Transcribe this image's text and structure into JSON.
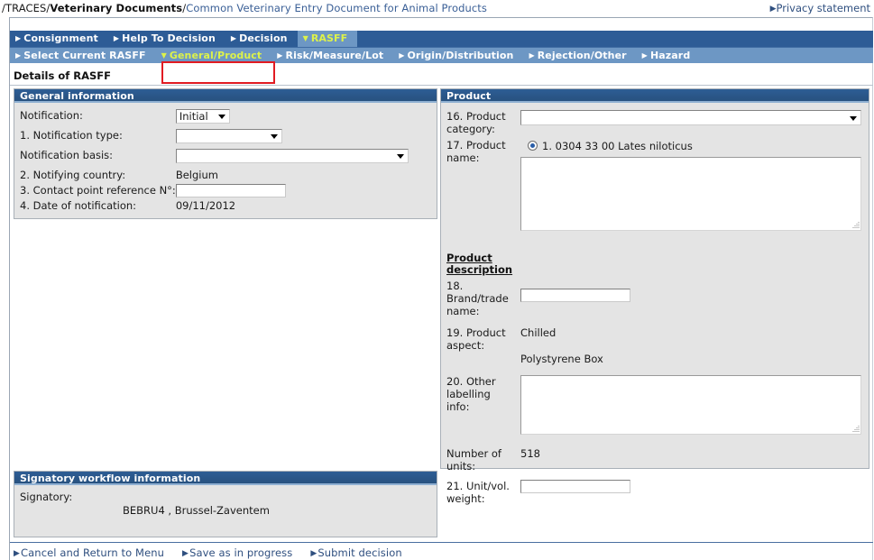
{
  "breadcrumb": {
    "root": "/TRACES/",
    "section": "Veterinary Documents",
    "separator": "/",
    "current": "Common Veterinary Entry Document for Animal Products"
  },
  "privacy": {
    "label": "Privacy statement",
    "arrow": "▶"
  },
  "tabs_primary": [
    {
      "label": "Consignment",
      "arrow": "▶",
      "active": false
    },
    {
      "label": "Help To Decision",
      "arrow": "▶",
      "active": false
    },
    {
      "label": "Decision",
      "arrow": "▶",
      "active": false
    },
    {
      "label": "RASFF",
      "arrow": "▼",
      "active": true
    }
  ],
  "tabs_secondary": [
    {
      "label": "Select Current RASFF",
      "arrow": "▶",
      "active": false
    },
    {
      "label": "General/Product",
      "arrow": "▼",
      "active": true
    },
    {
      "label": "Risk/Measure/Lot",
      "arrow": "▶",
      "active": false
    },
    {
      "label": "Origin/Distribution",
      "arrow": "▶",
      "active": false
    },
    {
      "label": "Rejection/Other",
      "arrow": "▶",
      "active": false
    },
    {
      "label": "Hazard",
      "arrow": "▶",
      "active": false
    }
  ],
  "page_title": "Details of RASFF",
  "general": {
    "header": "General information",
    "notification_label": "Notification:",
    "notification_value": "Initial",
    "notification_type_label": "1. Notification type:",
    "notification_type_value": "",
    "notification_basis_label": "Notification basis:",
    "notification_basis_value": "",
    "notifying_country_label": "2. Notifying country:",
    "notifying_country_value": "Belgium",
    "contact_point_label": "3. Contact point reference N°:",
    "contact_point_value": "",
    "date_label": "4. Date of notification:",
    "date_value": "09/11/2012"
  },
  "product": {
    "header": "Product",
    "category_label": "16. Product category:",
    "category_value": "",
    "name_label": "17. Product name:",
    "name_option": "1. 0304 33 00 Lates niloticus",
    "name_option_selected": true,
    "name_textarea_value": "",
    "description_title": "Product description",
    "brand_label": "18. Brand/trade name:",
    "brand_value": "",
    "aspect_label": "19. Product aspect:",
    "aspect_value": "Chilled",
    "aspect_value2": "Polystyrene Box",
    "labelling_label": "20. Other labelling info:",
    "labelling_value": "",
    "units_label": "Number of units:",
    "units_value": "518",
    "weight_label": "21. Unit/vol. weight:",
    "weight_value": ""
  },
  "signatory": {
    "header": "Signatory workflow information",
    "label": "Signatory:",
    "value": "BEBRU4 , Brussel-Zaventem"
  },
  "actions": [
    {
      "label": "Cancel and Return to Menu",
      "arrow": "▶"
    },
    {
      "label": "Save as in progress",
      "arrow": "▶"
    },
    {
      "label": "Submit decision",
      "arrow": "▶"
    }
  ],
  "colors": {
    "tabrow_primary": "#2d5c96",
    "tabrow_secondary": "#6d97c4",
    "active_tab_text": "#ddf24a",
    "highlight_border": "#e11b22",
    "panel_header": "#2a5689",
    "panel_bg": "#e4e4e4",
    "link": "#2f4f7f"
  }
}
